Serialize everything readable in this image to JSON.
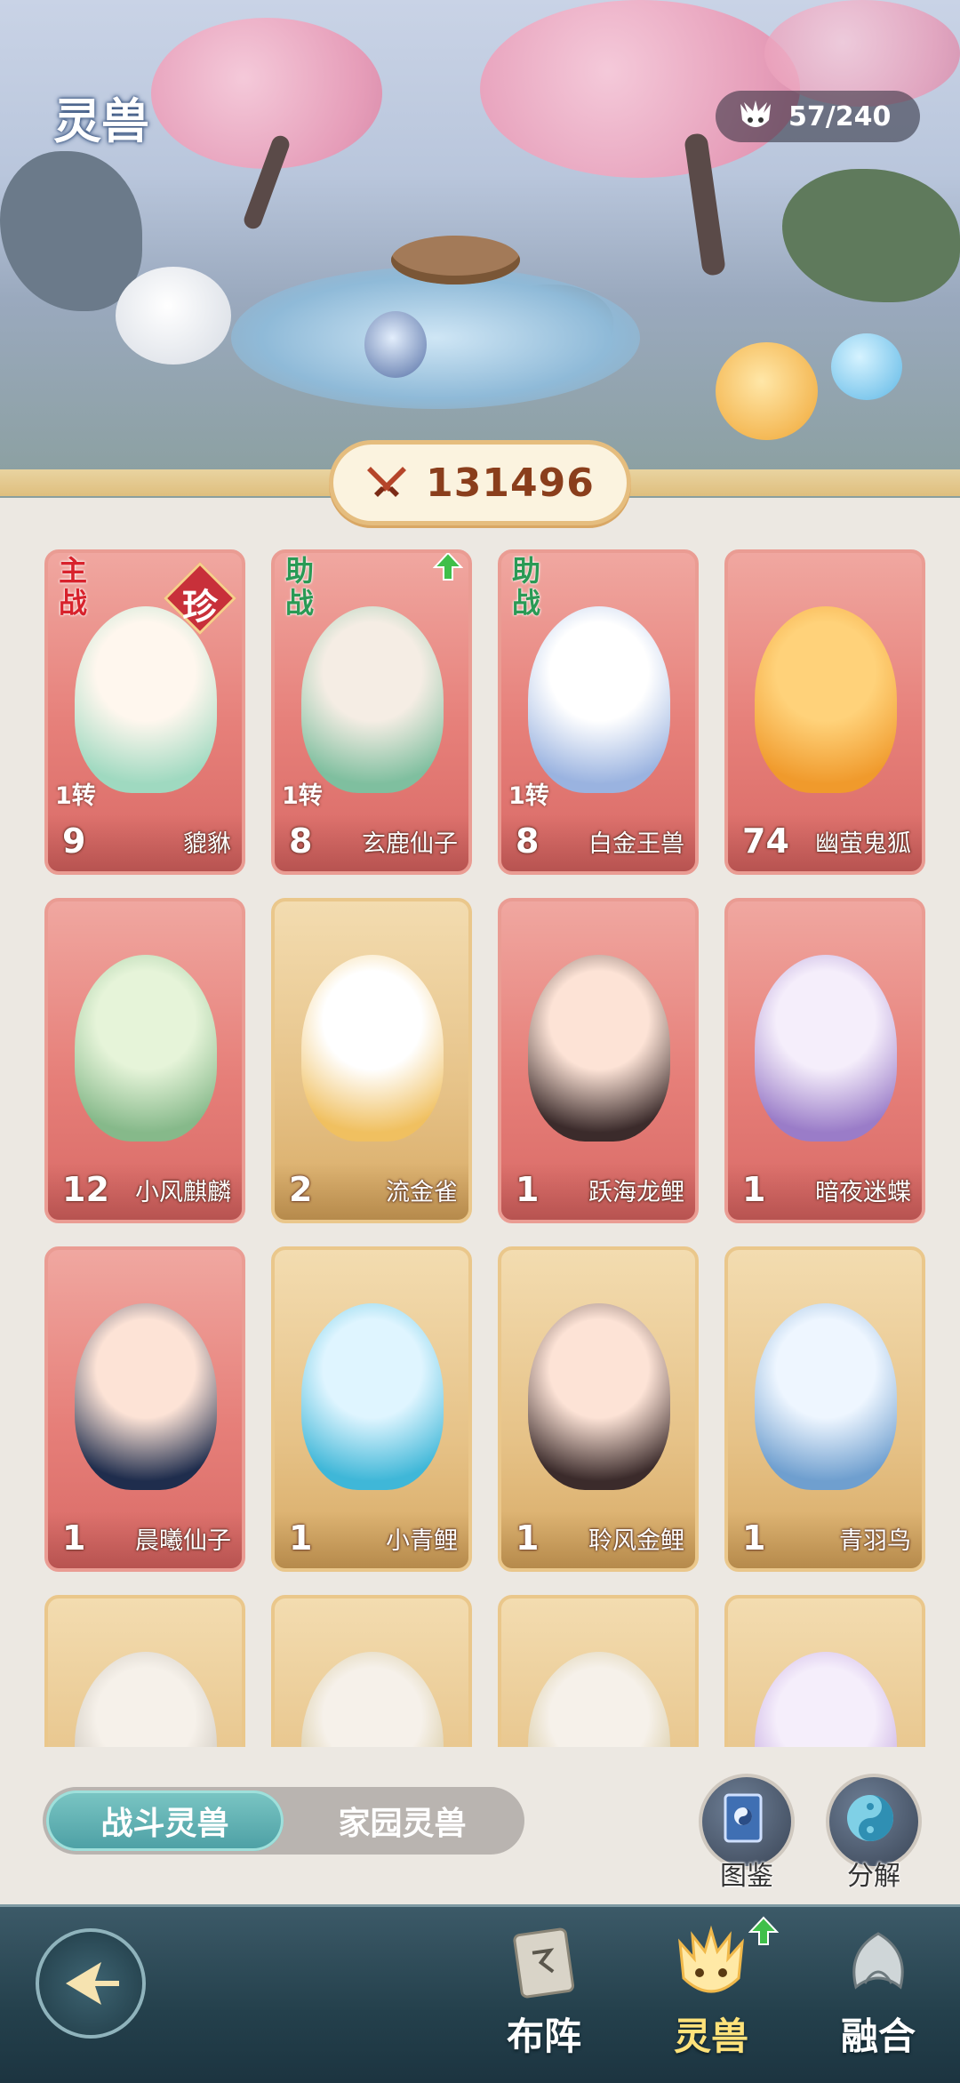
{
  "header": {
    "title": "灵兽",
    "count_text": "57/240",
    "power_value": "131496"
  },
  "cards": [
    {
      "name": "貔貅",
      "level": "9",
      "tier": "1转",
      "role": "主战",
      "rare": "珍",
      "style": "red",
      "upgrade": false
    },
    {
      "name": "玄鹿仙子",
      "level": "8",
      "tier": "1转",
      "role": "助战",
      "rare": "",
      "style": "red",
      "upgrade": true
    },
    {
      "name": "白金王兽",
      "level": "8",
      "tier": "1转",
      "role": "助战",
      "rare": "",
      "style": "red",
      "upgrade": false
    },
    {
      "name": "幽萤鬼狐",
      "level": "74",
      "tier": "",
      "role": "",
      "rare": "",
      "style": "red",
      "upgrade": false
    },
    {
      "name": "小风麒麟",
      "level": "12",
      "tier": "",
      "role": "",
      "rare": "",
      "style": "red",
      "upgrade": false
    },
    {
      "name": "流金雀",
      "level": "2",
      "tier": "",
      "role": "",
      "rare": "",
      "style": "gold",
      "upgrade": false
    },
    {
      "name": "跃海龙鲤",
      "level": "1",
      "tier": "",
      "role": "",
      "rare": "",
      "style": "red",
      "upgrade": false
    },
    {
      "name": "暗夜迷蝶",
      "level": "1",
      "tier": "",
      "role": "",
      "rare": "",
      "style": "red",
      "upgrade": false
    },
    {
      "name": "晨曦仙子",
      "level": "1",
      "tier": "",
      "role": "",
      "rare": "",
      "style": "red",
      "upgrade": false
    },
    {
      "name": "小青鲤",
      "level": "1",
      "tier": "",
      "role": "",
      "rare": "",
      "style": "gold",
      "upgrade": false
    },
    {
      "name": "聆风金鲤",
      "level": "1",
      "tier": "",
      "role": "",
      "rare": "",
      "style": "gold",
      "upgrade": false
    },
    {
      "name": "青羽鸟",
      "level": "1",
      "tier": "",
      "role": "",
      "rare": "",
      "style": "gold",
      "upgrade": false
    },
    {
      "name": "",
      "level": "",
      "tier": "",
      "role": "",
      "rare": "",
      "style": "gold",
      "upgrade": false
    },
    {
      "name": "",
      "level": "",
      "tier": "",
      "role": "",
      "rare": "",
      "style": "gold",
      "upgrade": false
    },
    {
      "name": "",
      "level": "",
      "tier": "",
      "role": "",
      "rare": "",
      "style": "gold",
      "upgrade": false
    },
    {
      "name": "",
      "level": "",
      "tier": "",
      "role": "",
      "rare": "",
      "style": "gold",
      "upgrade": false
    }
  ],
  "tabs": {
    "battle": "战斗灵兽",
    "home": "家园灵兽"
  },
  "tools": {
    "codex": "图鉴",
    "decompose": "分解"
  },
  "nav": {
    "formation": "布阵",
    "beasts": "灵兽",
    "fusion": "融合"
  },
  "icons": {
    "count": "beast-head-icon",
    "power": "crossed-swords-icon",
    "back": "back-arrow-icon",
    "codex": "book-icon",
    "decompose": "swirl-orb-icon",
    "formation": "scroll-icon",
    "beasts": "beast-face-icon",
    "fusion": "fusion-spirit-icon",
    "upgrade": "green-up-arrow-icon"
  },
  "colors": {
    "accent_teal": "#4c9fa4",
    "power_text": "#8a3e1c",
    "role_main": "#d8222c",
    "role_support": "#2a9a55",
    "upgrade_green": "#3fbf4a",
    "active_nav": "#ffe27a"
  }
}
